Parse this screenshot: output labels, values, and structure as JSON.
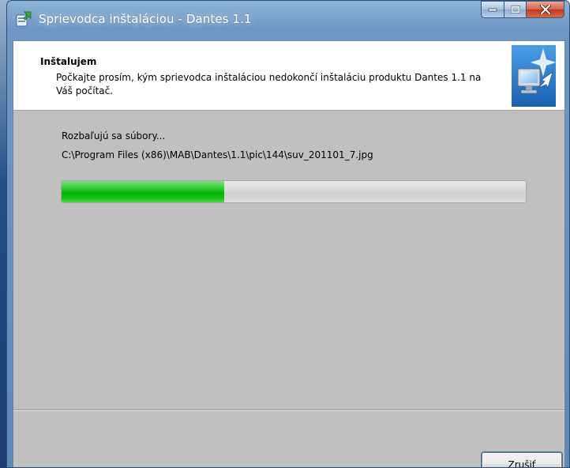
{
  "window": {
    "title": "Sprievodca inštaláciou - Dantes 1.1",
    "controls": {
      "minimize": "minimize",
      "maximize": "maximize",
      "close": "close"
    }
  },
  "header": {
    "title": "Inštalujem",
    "description": "Počkajte prosím, kým sprievodca inštaláciou nedokončí inštaláciu produktu Dantes 1.1 na Váš počítač."
  },
  "progress": {
    "status": "Rozbaľujú sa súbory...",
    "current_file": "C:\\Program Files (x86)\\MAB\\Dantes\\1.1\\pic\\144\\suv_201101_7.jpg",
    "fraction": 0.35,
    "fill_color": "#06b306"
  },
  "buttons": {
    "cancel_label": "Zrušiť"
  },
  "icons": {
    "app": "installer-icon",
    "header_graphic": "computer-install-icon"
  }
}
